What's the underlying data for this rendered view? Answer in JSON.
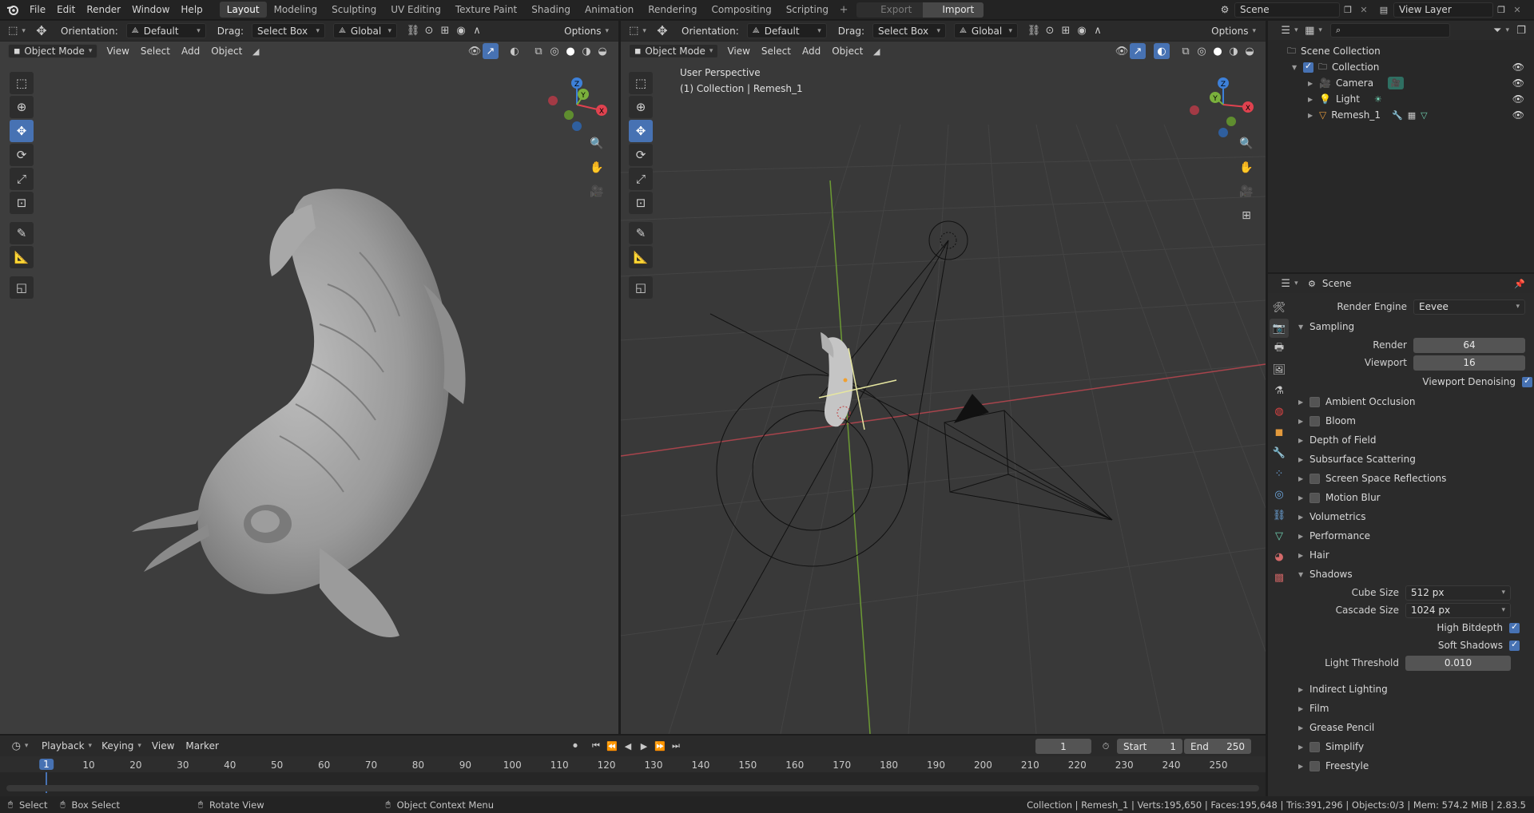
{
  "menu": [
    "File",
    "Edit",
    "Render",
    "Window",
    "Help"
  ],
  "workspaces": [
    "Layout",
    "Modeling",
    "Sculpting",
    "UV Editing",
    "Texture Paint",
    "Shading",
    "Animation",
    "Rendering",
    "Compositing",
    "Scripting"
  ],
  "active_workspace": "Layout",
  "top_buttons": {
    "export": "Export",
    "import": "Import"
  },
  "scene_name": "Scene",
  "view_layer": "View Layer",
  "viewport_header": {
    "orientation_label": "Orientation:",
    "orientation_value": "Default",
    "drag_label": "Drag:",
    "drag_value": "Select Box",
    "transform_value": "Global",
    "options": "Options"
  },
  "viewport_menu": {
    "mode": "Object Mode",
    "view": "View",
    "select": "Select",
    "add": "Add",
    "object": "Object"
  },
  "right_viewport": {
    "perspective": "User Perspective",
    "context": "(1) Collection | Remesh_1"
  },
  "outliner": {
    "root": "Scene Collection",
    "collection": "Collection",
    "items": [
      "Camera",
      "Light",
      "Remesh_1"
    ]
  },
  "properties": {
    "context": "Scene",
    "render_engine_label": "Render Engine",
    "render_engine": "Eevee",
    "sampling": {
      "title": "Sampling",
      "render_label": "Render",
      "render": "64",
      "viewport_label": "Viewport",
      "viewport": "16",
      "denoise": "Viewport Denoising"
    },
    "panels_a": [
      {
        "label": "Ambient Occlusion",
        "check": true
      },
      {
        "label": "Bloom",
        "check": true
      },
      {
        "label": "Depth of Field",
        "check": false
      },
      {
        "label": "Subsurface Scattering",
        "check": false
      },
      {
        "label": "Screen Space Reflections",
        "check": true
      },
      {
        "label": "Motion Blur",
        "check": true
      },
      {
        "label": "Volumetrics",
        "check": false
      },
      {
        "label": "Performance",
        "check": false
      },
      {
        "label": "Hair",
        "check": false
      }
    ],
    "shadows": {
      "title": "Shadows",
      "cube_label": "Cube Size",
      "cube": "512 px",
      "cascade_label": "Cascade Size",
      "cascade": "1024 px",
      "high_bitdepth": "High Bitdepth",
      "soft_shadows": "Soft Shadows",
      "threshold_label": "Light Threshold",
      "threshold": "0.010"
    },
    "panels_b": [
      {
        "label": "Indirect Lighting",
        "check": false
      },
      {
        "label": "Film",
        "check": false
      },
      {
        "label": "Grease Pencil",
        "check": false
      },
      {
        "label": "Simplify",
        "check": true
      },
      {
        "label": "Freestyle",
        "check": true
      }
    ]
  },
  "timeline": {
    "playback": "Playback",
    "keying": "Keying",
    "view": "View",
    "marker": "Marker",
    "current_frame": "1",
    "start_label": "Start",
    "start": "1",
    "end_label": "End",
    "end": "250",
    "ticks": [
      "1",
      "10",
      "20",
      "30",
      "40",
      "50",
      "60",
      "70",
      "80",
      "90",
      "100",
      "110",
      "120",
      "130",
      "140",
      "150",
      "160",
      "170",
      "180",
      "190",
      "200",
      "210",
      "220",
      "230",
      "240",
      "250"
    ]
  },
  "status": {
    "select": "Select",
    "box_select": "Box Select",
    "rotate_view": "Rotate View",
    "context_menu": "Object Context Menu",
    "stats": "Collection | Remesh_1 | Verts:195,650 | Faces:195,648 | Tris:391,296 | Objects:0/3 | Mem: 574.2 MiB | 2.83.5"
  },
  "colors": {
    "accent": "#4772b3",
    "x_axis": "#e0424f",
    "y_axis": "#7ab03c",
    "z_axis": "#3d80d9"
  }
}
